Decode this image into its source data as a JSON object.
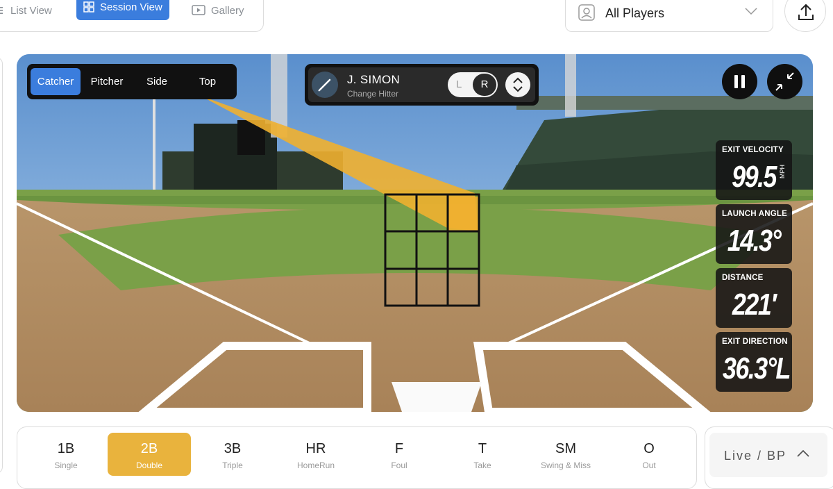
{
  "view_switch": {
    "items": [
      {
        "label": "List View",
        "icon": "list-icon"
      },
      {
        "label": "Session View",
        "icon": "grid-icon",
        "active": true
      },
      {
        "label": "Gallery",
        "icon": "play-icon"
      }
    ]
  },
  "player_select": {
    "value": "All Players"
  },
  "camera_tabs": [
    "Catcher",
    "Pitcher",
    "Side",
    "Top"
  ],
  "hitter": {
    "name": "J. SIMON",
    "subtitle": "Change Hitter",
    "left": "L",
    "right": "R",
    "selected_side": "R"
  },
  "stats": [
    {
      "title": "EXIT VELOCITY",
      "value": "99.5",
      "unit": "MPH"
    },
    {
      "title": "LAUNCH ANGLE",
      "value": "14.3°",
      "unit": ""
    },
    {
      "title": "DISTANCE",
      "value": "221′",
      "unit": ""
    },
    {
      "title": "EXIT DIRECTION",
      "value": "36.3°L",
      "unit": ""
    }
  ],
  "results": [
    {
      "code": "1B",
      "desc": "Single"
    },
    {
      "code": "2B",
      "desc": "Double",
      "active": true
    },
    {
      "code": "3B",
      "desc": "Triple"
    },
    {
      "code": "HR",
      "desc": "HomeRun"
    },
    {
      "code": "F",
      "desc": "Foul"
    },
    {
      "code": "T",
      "desc": "Take"
    },
    {
      "code": "SM",
      "desc": "Swing & Miss"
    },
    {
      "code": "O",
      "desc": "Out"
    }
  ],
  "mode": {
    "label": "Live / BP"
  },
  "colors": {
    "accent": "#3b7ddd",
    "result_active": "#e9b33d",
    "trajectory": "#f0b030"
  }
}
